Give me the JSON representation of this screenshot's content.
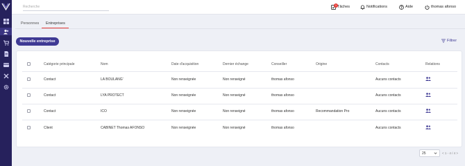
{
  "sidebar": {
    "logo_text": "VA",
    "items": [
      {
        "icon": "dashboard-icon"
      },
      {
        "icon": "users-icon",
        "active": true
      },
      {
        "icon": "cart-icon"
      },
      {
        "icon": "document-icon"
      },
      {
        "icon": "card-icon"
      },
      {
        "icon": "tools-icon"
      },
      {
        "icon": "gear-icon"
      }
    ]
  },
  "topbar": {
    "search_placeholder": "Recherche",
    "tasks_label": "Tâches",
    "tasks_badge": "1",
    "notifications_label": "Notifications",
    "help_label": "Aide",
    "user_label": "thomas afonso"
  },
  "tabs": [
    {
      "label": "Personnes",
      "active": false
    },
    {
      "label": "Entreprises",
      "active": true
    }
  ],
  "actions": {
    "new_button": "Nouvelle entreprise",
    "filter_label": "Filtrer"
  },
  "table": {
    "headers": {
      "category": "Catégorie principale",
      "name": "Nom",
      "acquisition": "Date d'acquisition",
      "last_exchange": "Dernier échange",
      "advisor": "Conseiller",
      "origin": "Origine",
      "contacts": "Contacts",
      "relations": "Relations"
    },
    "rows": [
      {
        "category": "Contact",
        "name": "LA BOULANG'",
        "acquisition": "Non renseignée",
        "last_exchange": "Non renseigné",
        "advisor": "thomas afonso",
        "origin": "",
        "contacts": "Aucuns contacts"
      },
      {
        "category": "Contact",
        "name": "LYA PROTECT",
        "acquisition": "Non renseignée",
        "last_exchange": "Non renseigné",
        "advisor": "thomas afonso",
        "origin": "",
        "contacts": "Aucuns contacts"
      },
      {
        "category": "Contact",
        "name": "ICO",
        "acquisition": "Non renseignée",
        "last_exchange": "Non renseigné",
        "advisor": "thomas afonso",
        "origin": "Recommandation Pro",
        "contacts": "Aucuns contacts"
      },
      {
        "category": "Client",
        "name": "CABINET Thomas AFONSO",
        "acquisition": "Non renseignée",
        "last_exchange": "Non renseigné",
        "advisor": "thomas afonso",
        "origin": "",
        "contacts": "Aucuns contacts"
      }
    ]
  },
  "pagination": {
    "per_page": "25",
    "range": "< 1 - 4 / 4 >"
  },
  "colors": {
    "sidebar": "#26215c",
    "accent": "#3f3a94",
    "tab_underline": "#e53935"
  }
}
